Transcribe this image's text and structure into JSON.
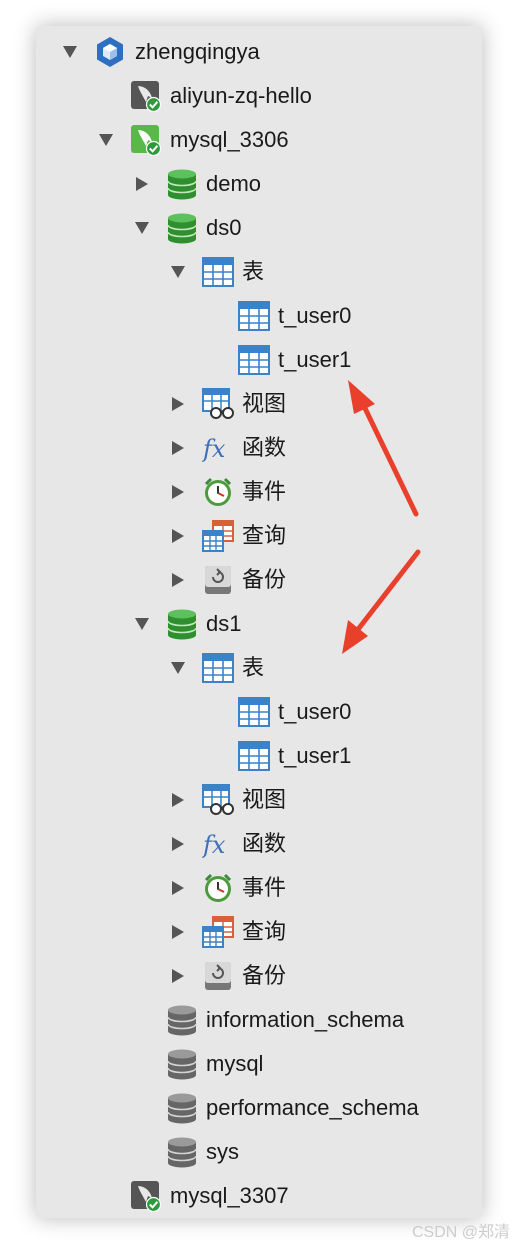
{
  "tree": {
    "root": {
      "label": "zhengqingya",
      "icon": "hexagon-cube-icon"
    },
    "aliyun": {
      "label": "aliyun-zq-hello",
      "icon": "connection-gray-icon"
    },
    "mysql3306": {
      "label": "mysql_3306",
      "icon": "connection-green-icon"
    },
    "demo": {
      "label": "demo",
      "icon": "database-green-icon"
    },
    "ds0": {
      "label": "ds0",
      "tables": {
        "label": "表",
        "items": [
          "t_user0",
          "t_user1"
        ]
      },
      "views": {
        "label": "视图"
      },
      "functions": {
        "label": "函数"
      },
      "events": {
        "label": "事件"
      },
      "queries": {
        "label": "查询"
      },
      "backups": {
        "label": "备份"
      }
    },
    "ds1": {
      "label": "ds1",
      "tables": {
        "label": "表",
        "items": [
          "t_user0",
          "t_user1"
        ]
      },
      "views": {
        "label": "视图"
      },
      "functions": {
        "label": "函数"
      },
      "events": {
        "label": "事件"
      },
      "queries": {
        "label": "查询"
      },
      "backups": {
        "label": "备份"
      }
    },
    "other_dbs": [
      "information_schema",
      "mysql",
      "performance_schema",
      "sys"
    ],
    "mysql3307": {
      "label": "mysql_3307",
      "icon": "connection-gray-icon"
    }
  },
  "watermark": "CSDN @郑清",
  "colors": {
    "arrow": "#e8402a",
    "db_green": "#3a9a3a",
    "table_blue": "#3c82c8"
  }
}
